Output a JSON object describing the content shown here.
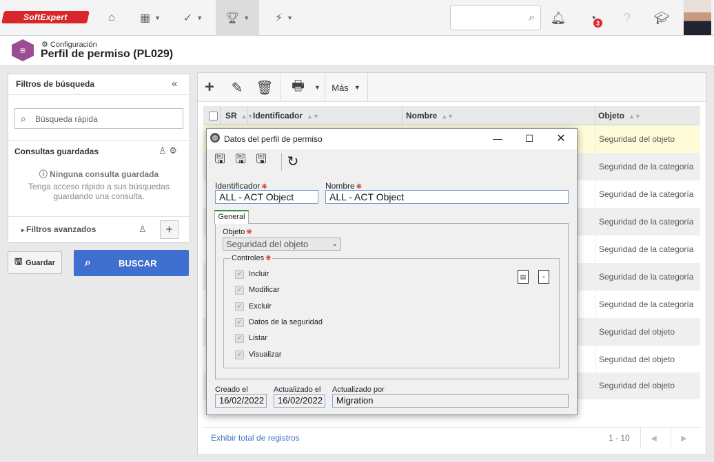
{
  "brand": {
    "logo_text": "SoftExpert"
  },
  "topnav": {
    "notification_count": "3"
  },
  "page": {
    "breadcrumb": "Configuración",
    "title": "Perfil de permiso (PL029)"
  },
  "filters": {
    "title": "Filtros de búsqueda",
    "quick_search_placeholder": "Búsqueda rápida",
    "saved_queries_label": "Consultas guardadas",
    "no_saved": "Ninguna consulta guardada",
    "no_saved_help": "Tenga acceso rápido a sus búsquedas guardando una consulta.",
    "advanced_label": "Filtros avanzados",
    "save_label": "Guardar",
    "search_label": "BUSCAR"
  },
  "toolbar": {
    "more_label": "Más"
  },
  "grid": {
    "columns": {
      "sr": "SR",
      "identifier": "Identificador",
      "name": "Nombre",
      "object": "Objeto"
    },
    "rows": [
      "Seguridad del objeto",
      "Seguridad de la categoría",
      "Seguridad de la categoría",
      "Seguridad de la categoría",
      "Seguridad de la categoría",
      "Seguridad de la categoría",
      "Seguridad de la categoría",
      "Seguridad del objeto",
      "Seguridad del objeto",
      "Seguridad del objeto"
    ],
    "show_total": "Exhibir total de registros",
    "page_info": "1 - 10"
  },
  "dialog": {
    "title": "Datos del perfil de permiso",
    "identifier_label": "Identificador",
    "identifier_value": "ALL - ACT Object",
    "name_label": "Nombre",
    "name_value": "ALL - ACT Object",
    "tab_general": "General",
    "object_label": "Objeto",
    "object_value": "Seguridad del objeto",
    "controls_label": "Controles",
    "controls": [
      "Incluir",
      "Modificar",
      "Excluir",
      "Datos de la seguridad",
      "Listar",
      "Visualizar"
    ],
    "created_label": "Creado el",
    "created_value": "16/02/2022",
    "updated_label": "Actualizado el",
    "updated_value": "16/02/2022",
    "updated_by_label": "Actualizado por",
    "updated_by_value": "Migration"
  },
  "colors": {
    "accent": "#3f6fcf",
    "module": "#9b4d93",
    "selected_row": "#fefbd8",
    "link": "#3a78c3"
  }
}
